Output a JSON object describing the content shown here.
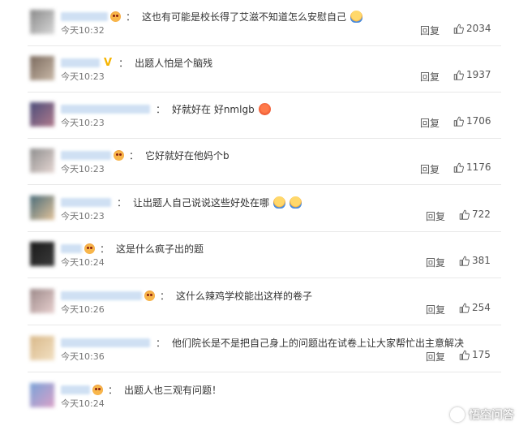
{
  "reply_label": "回复",
  "comments": [
    {
      "text": "这也有可能是校长得了艾滋不知道怎么安慰自己",
      "badge": "face",
      "emoji": [
        "blue"
      ],
      "time": "今天10:32",
      "likes": "2034",
      "avatar_colors": [
        "#8a8a8a",
        "#d8d8d8"
      ]
    },
    {
      "text": "出题人怕是个脑残",
      "badge": "v",
      "emoji": [],
      "time": "今天10:23",
      "likes": "1937",
      "avatar_colors": [
        "#7b6a5e",
        "#c9b9a8"
      ]
    },
    {
      "text": "好就好在 好nmlgb",
      "badge": "",
      "emoji": [
        "red"
      ],
      "time": "今天10:23",
      "likes": "1706",
      "avatar_colors": [
        "#4b4d7a",
        "#b07a8c"
      ]
    },
    {
      "text": "它好就好在他妈个b",
      "badge": "face",
      "emoji": [],
      "time": "今天10:23",
      "likes": "1176",
      "avatar_colors": [
        "#8e8e8e",
        "#e6d7d3"
      ]
    },
    {
      "text": "让出题人自己说说这些好处在哪",
      "badge": "",
      "emoji": [
        "blue",
        "blue"
      ],
      "time": "今天10:23",
      "likes": "722",
      "avatar_colors": [
        "#4a6c7a",
        "#e2c39a"
      ]
    },
    {
      "text": "这是什么疯子出的题",
      "badge": "face",
      "emoji": [],
      "time": "今天10:24",
      "likes": "381",
      "avatar_colors": [
        "#1a1a1a",
        "#3b3b3b"
      ]
    },
    {
      "text": "这什么辣鸡学校能出这样的卷子",
      "badge": "face",
      "emoji": [],
      "time": "今天10:26",
      "likes": "254",
      "avatar_colors": [
        "#9d8a8a",
        "#e8d0cf"
      ]
    },
    {
      "text": "他们院长是不是把自己身上的问题出在试卷上让大家帮忙出主意解决",
      "badge": "",
      "emoji": [],
      "time": "今天10:36",
      "likes": "175",
      "avatar_colors": [
        "#d9b98a",
        "#f2e0c2"
      ]
    },
    {
      "text": "出题人也三观有问题！",
      "badge": "face",
      "emoji": [],
      "time": "今天10:24",
      "likes": "",
      "avatar_colors": [
        "#7aa3d8",
        "#d9a0c8"
      ]
    }
  ],
  "watermark": {
    "text": "悟空问答"
  }
}
